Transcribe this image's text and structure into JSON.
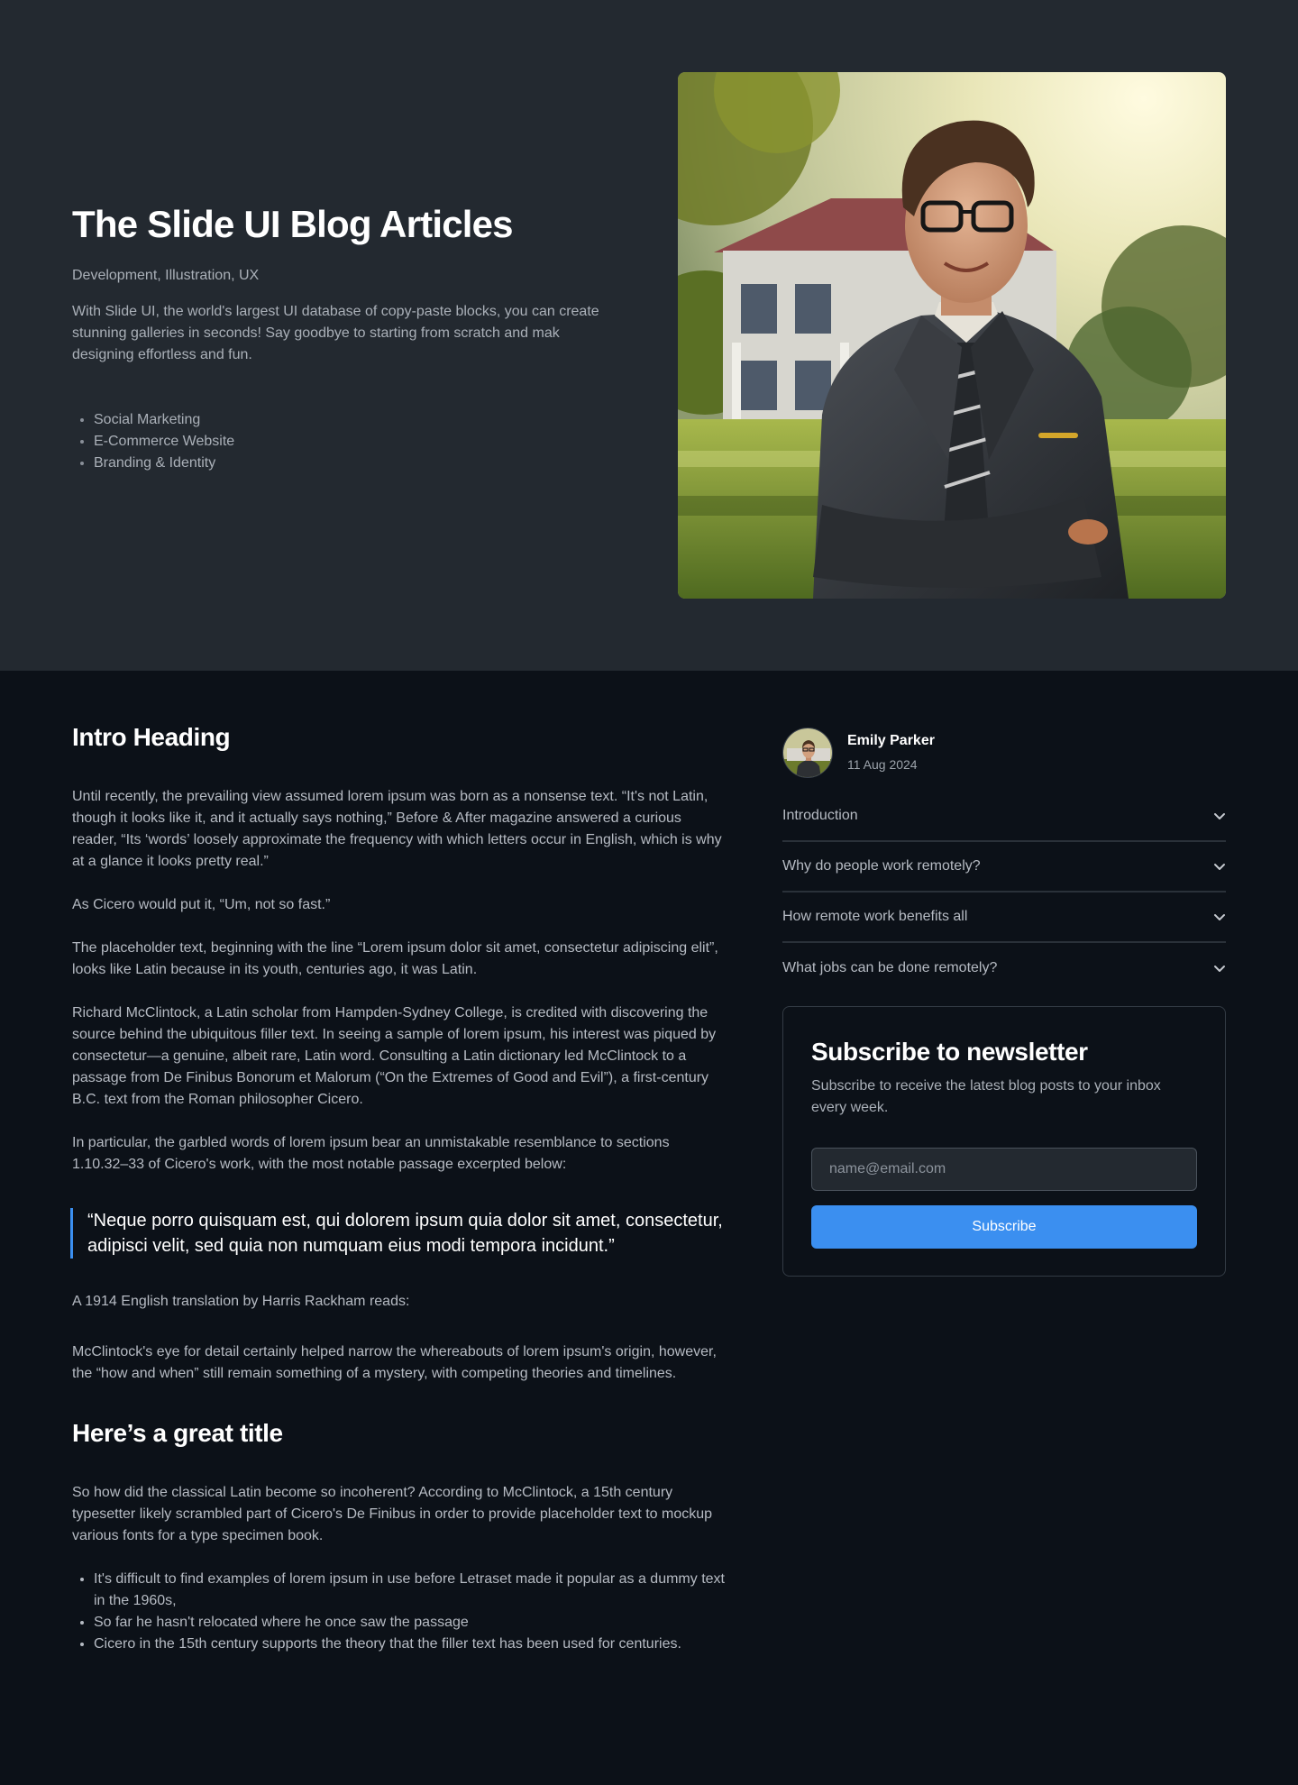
{
  "hero": {
    "title": "The Slide UI Blog Articles",
    "tags": "Development, Illustration, UX",
    "description": "With Slide UI, the world's largest UI database of copy-paste blocks, you can create stunning galleries in seconds! Say goodbye to starting from scratch and mak designing effortless and fun.",
    "list": [
      "Social Marketing",
      "E-Commerce Website",
      "Branding & Identity"
    ]
  },
  "article": {
    "intro_heading": "Intro Heading",
    "paragraphs": [
      "Until recently, the prevailing view assumed lorem ipsum was born as a nonsense text. “It's not Latin, though it looks like it, and it actually says nothing,” Before & After magazine answered a curious reader, “Its ‘words’ loosely approximate the frequency with which letters occur in English, which is why at a glance it looks pretty real.”",
      "As Cicero would put it, “Um, not so fast.”",
      "The placeholder text, beginning with the line “Lorem ipsum dolor sit amet, consectetur adipiscing elit”, looks like Latin because in its youth, centuries ago, it was Latin.",
      "Richard McClintock, a Latin scholar from Hampden-Sydney College, is credited with discovering the source behind the ubiquitous filler text. In seeing a sample of lorem ipsum, his interest was piqued by consectetur—a genuine, albeit rare, Latin word. Consulting a Latin dictionary led McClintock to a passage from De Finibus Bonorum et Malorum (“On the Extremes of Good and Evil”), a first-century B.C. text from the Roman philosopher Cicero.",
      "In particular, the garbled words of lorem ipsum bear an unmistakable resemblance to sections 1.10.32–33 of Cicero's work, with the most notable passage excerpted below:"
    ],
    "quote": "“Neque porro quisquam est, qui dolorem ipsum quia dolor sit amet, consectetur, adipisci velit, sed quia non numquam eius modi tempora incidunt.”",
    "after_quote": [
      "A 1914 English translation by Harris Rackham reads:",
      "McClintock's eye for detail certainly helped narrow the whereabouts of lorem ipsum's origin, however, the “how and when” still remain something of a mystery, with competing theories and timelines."
    ],
    "section_title": "Here’s a great title",
    "section_paragraph": "So how did the classical Latin become so incoherent? According to McClintock, a 15th century typesetter likely scrambled part of Cicero's De Finibus in order to provide placeholder text to mockup various fonts for a type specimen book.",
    "section_list": [
      "It's difficult to find examples of lorem ipsum in use before Letraset made it popular as a dummy text in the 1960s,",
      "So far he hasn't relocated where he once saw the passage",
      "Cicero in the 15th century supports the theory that the filler text has been used for centuries."
    ]
  },
  "sidebar": {
    "author": {
      "name": "Emily Parker",
      "date": "11 Aug 2024"
    },
    "accordion": [
      {
        "label": "Introduction",
        "icon": "chevron-down-icon"
      },
      {
        "label": "Why do people work remotely?",
        "icon": "chevron-down-icon"
      },
      {
        "label": "How remote work benefits all",
        "icon": "chevron-down-icon"
      },
      {
        "label": "What jobs can be done remotely?",
        "icon": "chevron-down-icon"
      }
    ],
    "newsletter": {
      "title": "Subscribe to newsletter",
      "description": "Subscribe to receive the latest blog posts to your inbox every week.",
      "input_placeholder": "name@email.com",
      "input_value": "",
      "button_label": "Subscribe"
    }
  },
  "colors": {
    "hero_bg": "#232930",
    "page_bg": "#0c1118",
    "accent": "#3b8ff0",
    "heading": "#ffffff",
    "body_text": "#b6bbc3"
  }
}
